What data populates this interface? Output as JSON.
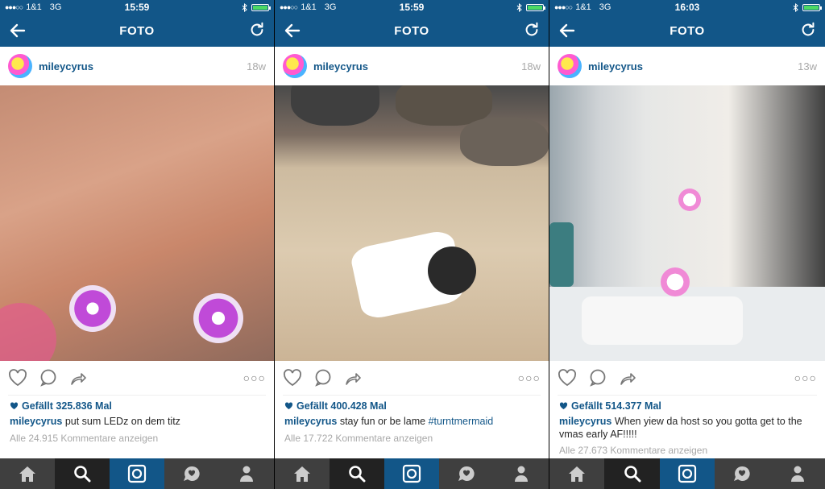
{
  "screens": [
    {
      "status": {
        "signal": "●●●○○",
        "carrier": "1&1",
        "network": "3G",
        "time": "15:59"
      },
      "nav": {
        "title": "FOTO"
      },
      "post": {
        "username": "mileycyrus",
        "age": "18w",
        "likes": "Gefällt 325.836 Mal",
        "caption_user": "mileycyrus",
        "caption_text": "put sum LEDz on dem titz",
        "caption_tag": "",
        "comments": "Alle 24.915 Kommentare anzeigen"
      }
    },
    {
      "status": {
        "signal": "●●●○○",
        "carrier": "1&1",
        "network": "3G",
        "time": "15:59"
      },
      "nav": {
        "title": "FOTO"
      },
      "post": {
        "username": "mileycyrus",
        "age": "18w",
        "likes": "Gefällt 400.428 Mal",
        "caption_user": "mileycyrus",
        "caption_text": "stay fun or be lame",
        "caption_tag": "#turntmermaid",
        "comments": "Alle 17.722 Kommentare anzeigen"
      }
    },
    {
      "status": {
        "signal": "●●●○○",
        "carrier": "1&1",
        "network": "3G",
        "time": "16:03"
      },
      "nav": {
        "title": "FOTO"
      },
      "post": {
        "username": "mileycyrus",
        "age": "13w",
        "likes": "Gefällt 514.377 Mal",
        "caption_user": "mileycyrus",
        "caption_text": "When yiew da host so you gotta get to the vmas early AF!!!!!",
        "caption_tag": "",
        "comments": "Alle 27.673 Kommentare anzeigen"
      }
    }
  ],
  "icons": {
    "back": "back-arrow-icon",
    "refresh": "refresh-icon",
    "like": "heart-icon",
    "comment": "comment-icon",
    "share": "share-icon",
    "more": "more-dots-icon",
    "home": "home-icon",
    "search": "search-icon",
    "camera": "camera-icon",
    "activity": "activity-heart-icon",
    "profile": "profile-icon"
  },
  "colors": {
    "brand": "#125688",
    "tabbar": "#3f3f3f",
    "muted": "#a8a8a8"
  }
}
